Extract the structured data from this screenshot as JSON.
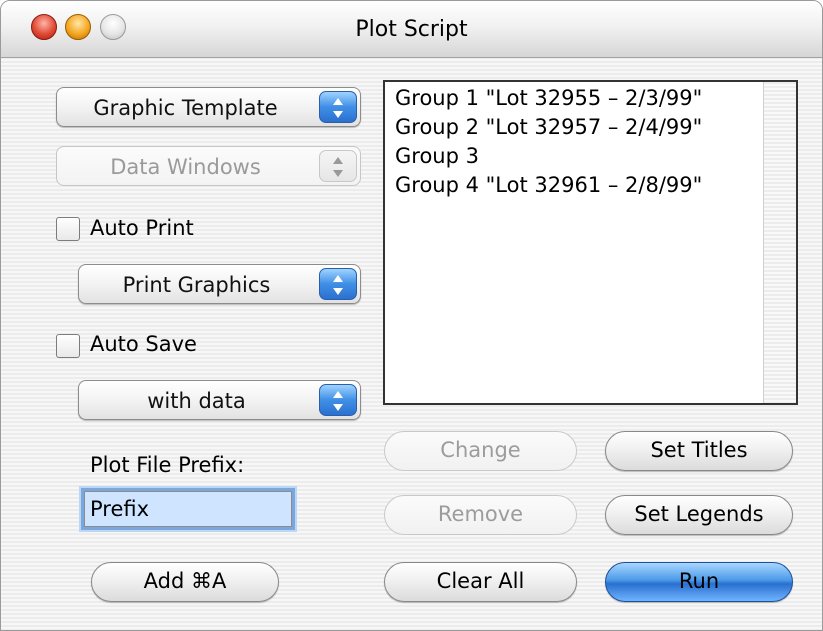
{
  "window": {
    "title": "Plot Script"
  },
  "popups": {
    "graphic_template": "Graphic Template",
    "data_windows": "Data Windows",
    "print_graphics": "Print Graphics",
    "with_data": "with data"
  },
  "checkboxes": {
    "auto_print": {
      "label": "Auto Print",
      "checked": false
    },
    "auto_save": {
      "label": "Auto Save",
      "checked": false
    }
  },
  "groups": [
    "Group 1 \"Lot 32955 – 2/3/99\"",
    "Group 2 \"Lot 32957 – 2/4/99\"",
    "Group 3",
    "Group 4 \"Lot 32961 – 2/8/99\""
  ],
  "prefix": {
    "label": "Plot File Prefix:",
    "value": "Prefix"
  },
  "buttons": {
    "change": "Change",
    "set_titles": "Set Titles",
    "remove": "Remove",
    "set_legends": "Set Legends",
    "add": "Add  ⌘A",
    "clear_all": "Clear All",
    "run": "Run"
  },
  "colors": {
    "accent": "#3f8fe6"
  }
}
